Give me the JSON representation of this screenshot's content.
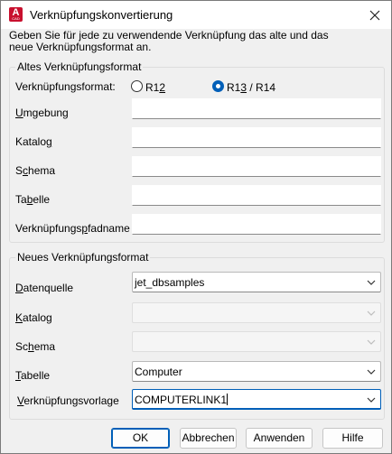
{
  "window": {
    "title": "Verknüpfungskonvertierung",
    "icon_text": "A",
    "icon_subtext": "CAD",
    "close_icon": "close-icon"
  },
  "intro": "Geben Sie für jede zu verwendende Verknüpfung das alte und das neue Verknüpfungsformat an.",
  "old_format": {
    "group_title": "Altes Verknüpfungsformat",
    "format_label": "Verknüpfungsformat:",
    "radio_r12": {
      "pre": "R1",
      "accel": "2",
      "post": "",
      "selected": false
    },
    "radio_r13": {
      "pre": "R1",
      "accel": "3",
      "post": " / R14",
      "selected": true
    },
    "fields": [
      {
        "accel": "U",
        "rest": "mgebung",
        "value": ""
      },
      {
        "pre": "Katalo",
        "accel": "g",
        "rest": "",
        "value": ""
      },
      {
        "pre": "S",
        "accel": "c",
        "rest": "hema",
        "value": ""
      },
      {
        "pre": "Ta",
        "accel": "b",
        "rest": "elle",
        "value": ""
      },
      {
        "pre": "Verknüpfungs",
        "accel": "p",
        "rest": "fadname",
        "value": ""
      }
    ]
  },
  "new_format": {
    "group_title": "Neues Verknüpfungsformat",
    "datasource": {
      "accel": "D",
      "rest": "atenquelle",
      "value": "jet_dbsamples"
    },
    "catalog": {
      "accel": "K",
      "rest": "atalog",
      "value": ""
    },
    "schema": {
      "pre": "Sc",
      "accel": "h",
      "rest": "ema",
      "value": ""
    },
    "table": {
      "accel": "T",
      "rest": "abelle",
      "value": "Computer"
    },
    "template": {
      "pre": "",
      "accel": "V",
      "rest": "erknüpfungsvorlage",
      "value": "COMPUTERLINK1"
    }
  },
  "buttons": {
    "ok": "OK",
    "cancel": "Abbrechen",
    "apply": "Anwenden",
    "help": "Hilfe"
  },
  "colors": {
    "accent": "#005fb8",
    "app_icon": "#c8102e"
  }
}
